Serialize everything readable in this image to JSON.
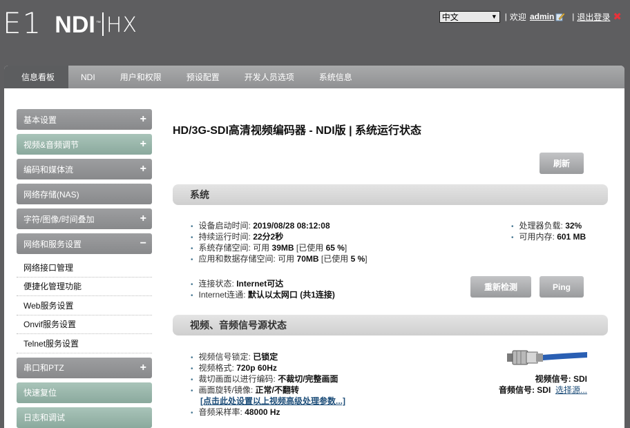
{
  "header": {
    "logo_main": "E1",
    "logo_ndi": "NDI",
    "logo_tm": "™",
    "logo_hx": "HX",
    "language": "中文",
    "welcome": "欢迎",
    "username": "admin",
    "logout": "退出登录",
    "separator": "|"
  },
  "nav": {
    "tabs": [
      "信息看板",
      "NDI",
      "用户和权限",
      "预设配置",
      "开发人员选项",
      "系统信息"
    ]
  },
  "sidebar": {
    "items": [
      {
        "label": "基本设置",
        "sign": "+"
      },
      {
        "label": "视频&音频调节",
        "sign": "+"
      },
      {
        "label": "编码和媒体流",
        "sign": "+"
      },
      {
        "label": "网络存储(NAS)",
        "sign": ""
      },
      {
        "label": "字符/图像/时间叠加",
        "sign": "+"
      },
      {
        "label": "网络和服务设置",
        "sign": "−"
      },
      {
        "label": "串口和PTZ",
        "sign": "+"
      },
      {
        "label": "快速复位",
        "sign": ""
      },
      {
        "label": "日志和调试",
        "sign": ""
      }
    ],
    "sub_items": [
      "网络接口管理",
      "便捷化管理功能",
      "Web服务设置",
      "Onvif服务设置",
      "Telnet服务设置"
    ]
  },
  "content": {
    "title": "HD/3G-SDI高清视频编码器 - NDI版 | 系统运行状态",
    "refresh_button": "刷新",
    "system_section": "系统",
    "boot_time_label": "设备启动时间: ",
    "boot_time": "2019/08/28 08:12:08",
    "uptime_label": "持续运行时间: ",
    "uptime": "22分2秒",
    "sys_storage_label": "系统存储空间: 可用 ",
    "sys_storage_avail": "39MB",
    "sys_storage_used_pre": " [已使用 ",
    "sys_storage_used": "65 %",
    "sys_storage_used_post": "]",
    "app_storage_label": "应用和数据存储空间: 可用 ",
    "app_storage_avail": "70MB",
    "app_storage_used_pre": " [已使用 ",
    "app_storage_used": "5 %",
    "app_storage_used_post": "]",
    "cpu_label": "处理器负载: ",
    "cpu": "32%",
    "mem_label": "可用内存: ",
    "mem": "601 MB",
    "conn_label": "连接状态: ",
    "conn": "Internet可达",
    "internet_label": "Internet连通: ",
    "internet": "默认以太网口 (共1连接)",
    "recheck_button": "重新检测",
    "ping_button": "Ping",
    "av_section": "视频、音频信号源状态",
    "lock_label": "视频信号锁定: ",
    "lock": "已锁定",
    "format_label": "视频格式: ",
    "format": "720p 60Hz",
    "crop_label": "裁切画面以进行编码: ",
    "crop": "不裁切/完整画面",
    "rotate_label": "画面旋转/镜像: ",
    "rotate": "正常/不翻转",
    "advanced_link": "[点击此处设置以上视频高级处理参数...]",
    "sample_label": "音频采样率: ",
    "sample": "48000 Hz",
    "video_signal": "视频信号: SDI",
    "audio_signal": "音频信号: SDI",
    "select_source": "选择源..."
  }
}
